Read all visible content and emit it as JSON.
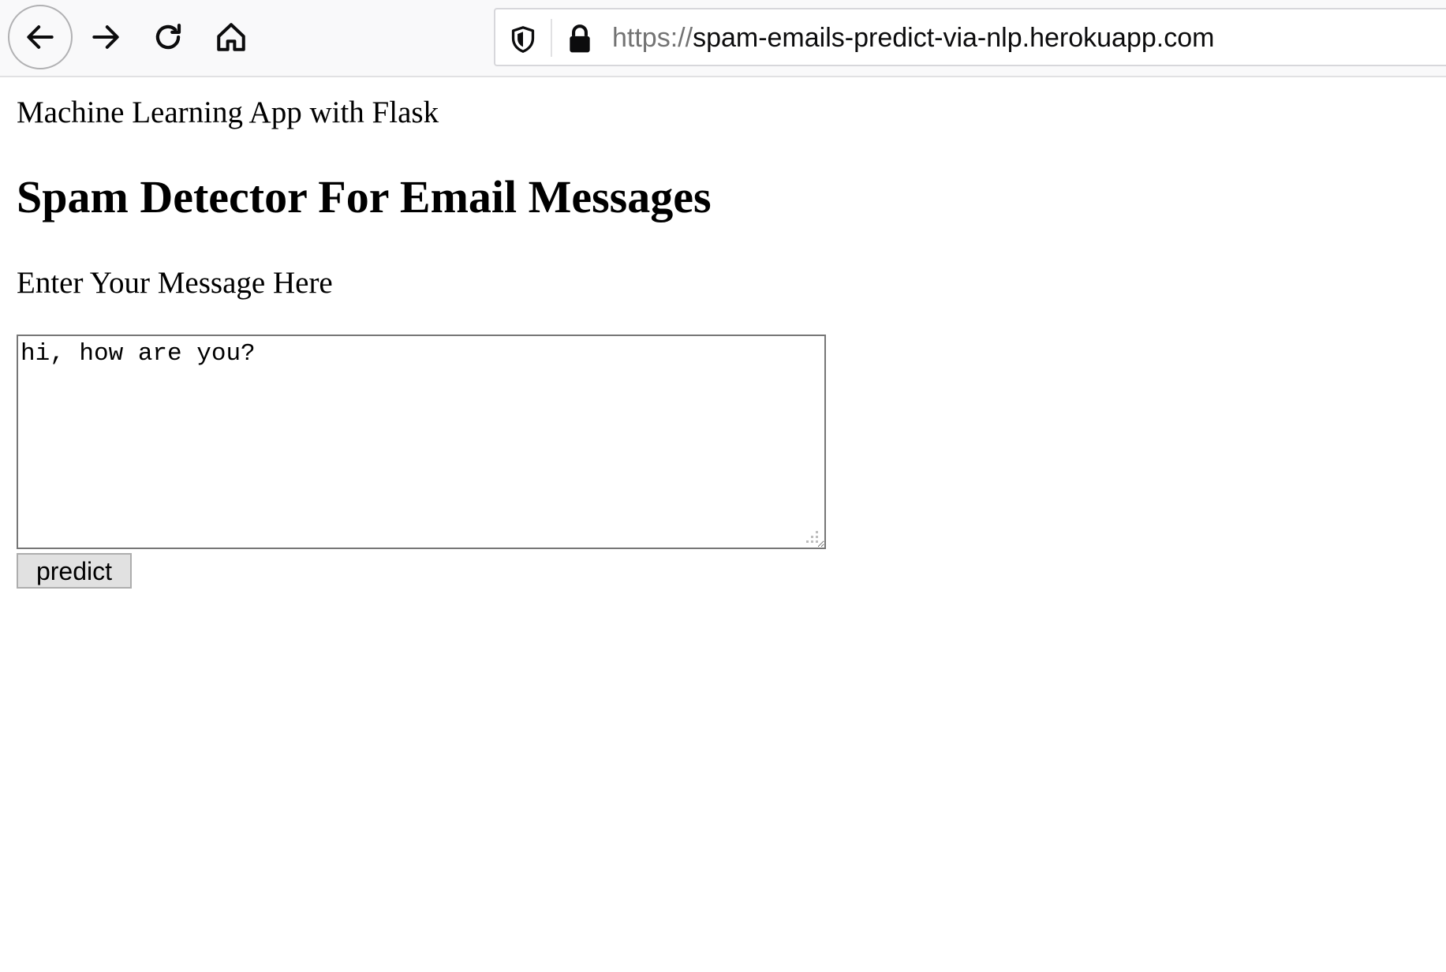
{
  "browser": {
    "url_scheme": "https://",
    "url_host": "spam-emails-predict-via-nlp.herokuapp.com"
  },
  "page": {
    "app_label": "Machine Learning App with Flask",
    "title": "Spam Detector For Email Messages",
    "prompt_label": "Enter Your Message Here",
    "message_value": "hi, how are you?",
    "predict_label": "predict"
  },
  "icons": {
    "back": "back-arrow-icon",
    "forward": "forward-arrow-icon",
    "reload": "reload-icon",
    "home": "home-icon",
    "shield": "tracking-protection-shield-icon",
    "lock": "padlock-icon"
  },
  "colors": {
    "toolbar_bg": "#f9f9fa",
    "icon": "#0c0c0d",
    "url_scheme": "#737373",
    "button_bg": "#e1e1e1"
  }
}
